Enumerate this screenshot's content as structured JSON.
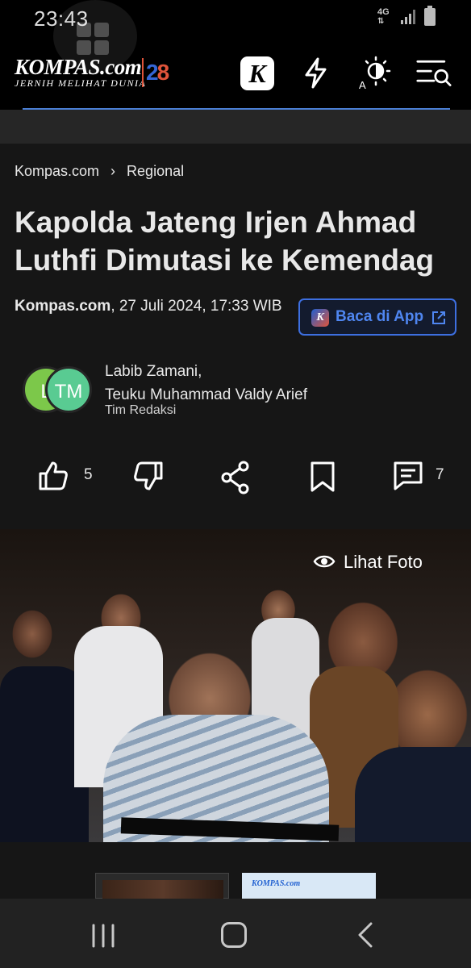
{
  "status_bar": {
    "time": "23:43",
    "network": "4G",
    "icons": [
      "signal-icon",
      "battery-icon"
    ]
  },
  "header": {
    "brand": "KOMPAS.com",
    "tagline": "JERNIH MELIHAT DUNIA",
    "anniversary_first": "2",
    "anniversary_second": "8",
    "icons": [
      "k-app-icon",
      "lightning-icon",
      "theme-contrast-icon",
      "menu-search-icon"
    ]
  },
  "breadcrumb": {
    "home": "Kompas.com",
    "separator": "›",
    "section": "Regional"
  },
  "article": {
    "title": "Kapolda Jateng Irjen Ahmad Luthfi Dimutasi ke Kemendag",
    "source": "Kompas.com",
    "date": ", 27 Juli 2024, 17:33 WIB",
    "app_button": "Baca di App",
    "authors": {
      "avatar_1": "L",
      "avatar_2": "TM",
      "line_1": "Labib Zamani,",
      "line_2": "Teuku Muhammad Valdy Arief",
      "team": "Tim Redaksi"
    },
    "actions": {
      "likes": "5",
      "comments": "7"
    }
  },
  "photo": {
    "view_label": "Lihat Foto"
  },
  "related": {
    "thumb_brand": "KOMPAS.com"
  },
  "colors": {
    "accent_blue": "#3d6fe0",
    "accent_red": "#e0543a",
    "background": "#161616"
  }
}
